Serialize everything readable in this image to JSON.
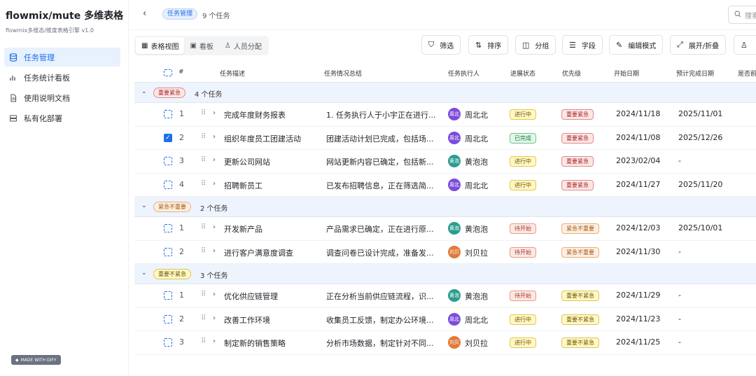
{
  "app": {
    "title": "flowmix/mute 多维表格",
    "subtitle": "flowmix多维态/维度表格引擎 v1.0"
  },
  "sidebar": {
    "items": [
      {
        "label": "任务管理",
        "icon": "database-icon",
        "active": true
      },
      {
        "label": "任务统计看板",
        "icon": "bar-chart-icon",
        "active": false
      },
      {
        "label": "使用说明文档",
        "icon": "document-icon",
        "active": false
      },
      {
        "label": "私有化部署",
        "icon": "server-icon",
        "active": false
      }
    ],
    "made_with": "MADE WITH DIFY"
  },
  "header": {
    "title_tag": "任务管理",
    "task_count": "9 个任务",
    "search_placeholder": "搜索"
  },
  "toolbar": {
    "views": [
      {
        "label": "表格视图",
        "icon": "table-icon",
        "active": true
      },
      {
        "label": "看板",
        "icon": "kanban-icon",
        "active": false
      },
      {
        "label": "人员分配",
        "icon": "user-icon",
        "active": false
      }
    ],
    "buttons": [
      {
        "label": "筛选",
        "icon": "filter-icon"
      },
      {
        "label": "排序",
        "icon": "sort-icon"
      },
      {
        "label": "分组",
        "icon": "group-icon"
      },
      {
        "label": "字段",
        "icon": "fields-icon"
      },
      {
        "label": "编辑模式",
        "icon": "edit-icon"
      },
      {
        "label": "展开/折叠",
        "icon": "expand-icon"
      },
      {
        "label": "",
        "icon": "user-icon"
      }
    ]
  },
  "table": {
    "columns": [
      "#",
      "任务描述",
      "任务情况总结",
      "任务执行人",
      "进展状态",
      "优先级",
      "开始日期",
      "预计完成日期",
      "是否前"
    ],
    "groups": [
      {
        "label": "重要紧急",
        "count": "4 个任务",
        "color": "#d14343",
        "rows": [
          {
            "num": "1",
            "desc": "完成年度财务报表",
            "summary": "1. 任务执行人于小宇正在进行...",
            "avatar": "周北",
            "avatar_color": "#7c4ddb",
            "person": "周北北",
            "status": "进行中",
            "priority": "重要紧急",
            "start": "2024/11/18",
            "end": "2025/11/01",
            "checked": false
          },
          {
            "num": "2",
            "desc": "组织年度员工团建活动",
            "summary": "团建活动计划已完成，包括场...",
            "avatar": "周北",
            "avatar_color": "#7c4ddb",
            "person": "周北北",
            "status": "已完成",
            "priority": "重要紧急",
            "start": "2024/11/08",
            "end": "2025/12/26",
            "checked": true
          },
          {
            "num": "3",
            "desc": "更新公司网站",
            "summary": "网站更新内容已确定，包括新...",
            "avatar": "黄泡",
            "avatar_color": "#2a9d8f",
            "person": "黄泡泡",
            "status": "进行中",
            "priority": "重要紧急",
            "start": "2023/02/04",
            "end": "-",
            "checked": false
          },
          {
            "num": "4",
            "desc": "招聘新员工",
            "summary": "已发布招聘信息，正在筛选简...",
            "avatar": "周北",
            "avatar_color": "#7c4ddb",
            "person": "周北北",
            "status": "进行中",
            "priority": "重要紧急",
            "start": "2024/11/27",
            "end": "2025/11/20",
            "checked": false
          }
        ]
      },
      {
        "label": "紧急不重要",
        "count": "2 个任务",
        "color": "#d9822b",
        "rows": [
          {
            "num": "1",
            "desc": "开发新产品",
            "summary": "产品需求已确定，正在进行原...",
            "avatar": "黄泡",
            "avatar_color": "#2a9d8f",
            "person": "黄泡泡",
            "status": "待开始",
            "priority": "紧急不重要",
            "start": "2024/12/03",
            "end": "2025/10/01",
            "checked": false
          },
          {
            "num": "2",
            "desc": "进行客户满意度调查",
            "summary": "调查问卷已设计完成，准备发...",
            "avatar": "刘贝",
            "avatar_color": "#e07b39",
            "person": "刘贝拉",
            "status": "待开始",
            "priority": "紧急不重要",
            "start": "2024/11/30",
            "end": "-",
            "checked": false
          }
        ]
      },
      {
        "label": "重要不紧急",
        "count": "3 个任务",
        "color": "#c9a227",
        "rows": [
          {
            "num": "1",
            "desc": "优化供应链管理",
            "summary": "正在分析当前供应链流程，识...",
            "avatar": "黄泡",
            "avatar_color": "#2a9d8f",
            "person": "黄泡泡",
            "status": "待开始",
            "priority": "重要不紧急",
            "start": "2024/11/29",
            "end": "-",
            "checked": false
          },
          {
            "num": "2",
            "desc": "改善工作环境",
            "summary": "收集员工反馈，制定办公环境...",
            "avatar": "周北",
            "avatar_color": "#7c4ddb",
            "person": "周北北",
            "status": "进行中",
            "priority": "重要不紧急",
            "start": "2024/11/23",
            "end": "-",
            "checked": false
          },
          {
            "num": "3",
            "desc": "制定新的销售策略",
            "summary": "分析市场数据，制定针对不同...",
            "avatar": "刘贝",
            "avatar_color": "#e07b39",
            "person": "刘贝拉",
            "status": "进行中",
            "priority": "重要不紧急",
            "start": "2024/11/25",
            "end": "-",
            "checked": false
          }
        ]
      }
    ]
  },
  "colors": {
    "accent": "#1e6fe8",
    "status_in_progress_bg": "#fff8c5",
    "status_done_bg": "#e3f7ea",
    "status_todo_bg": "#fde8e4",
    "prio_urgent_bg": "#fde6e6",
    "prio_urgent_not_important_bg": "#fdeee0",
    "prio_important_not_urgent_bg": "#fff8c5"
  }
}
